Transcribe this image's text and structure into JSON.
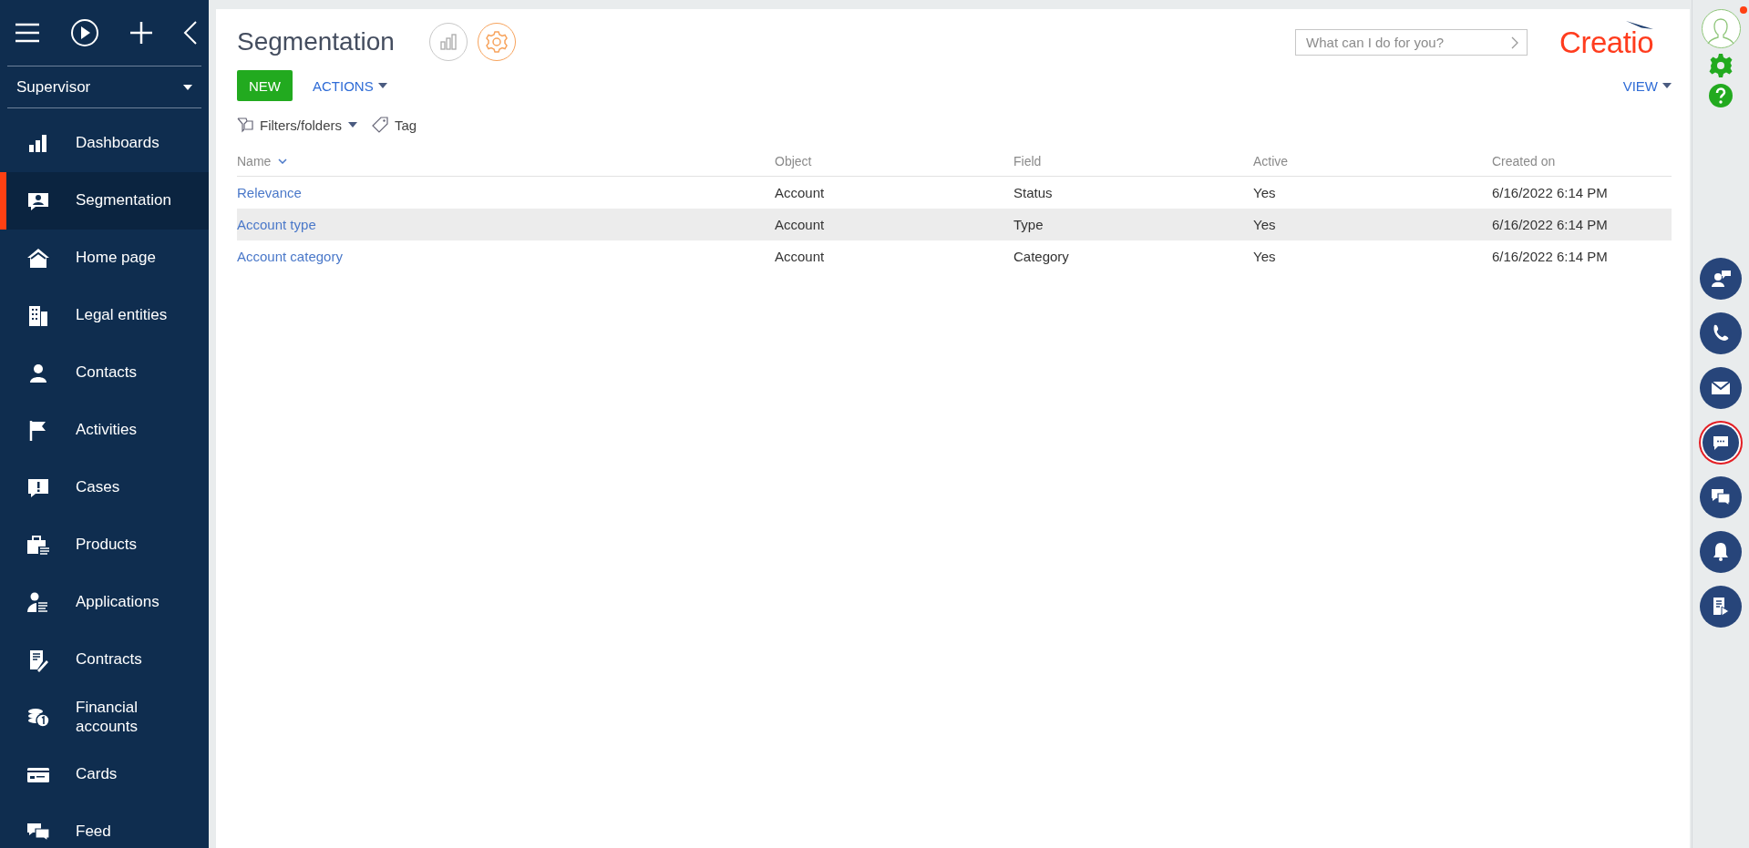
{
  "sidebar": {
    "role": "Supervisor",
    "items": [
      {
        "label": "Dashboards",
        "selected": false
      },
      {
        "label": "Segmentation",
        "selected": true
      },
      {
        "label": "Home page",
        "selected": false
      },
      {
        "label": "Legal entities",
        "selected": false
      },
      {
        "label": "Contacts",
        "selected": false
      },
      {
        "label": "Activities",
        "selected": false
      },
      {
        "label": "Cases",
        "selected": false
      },
      {
        "label": "Products",
        "selected": false
      },
      {
        "label": "Applications",
        "selected": false
      },
      {
        "label": "Contracts",
        "selected": false
      },
      {
        "label": "Financial accounts",
        "selected": false
      },
      {
        "label": "Cards",
        "selected": false
      },
      {
        "label": "Feed",
        "selected": false
      }
    ]
  },
  "header": {
    "title": "Segmentation",
    "search": {
      "placeholder": "What can I do for you?"
    },
    "logo": "Creatio"
  },
  "toolbar": {
    "new_button": "NEW",
    "actions_button": "ACTIONS",
    "view_button": "VIEW"
  },
  "filters": {
    "filters_folders": "Filters/folders",
    "tag": "Tag"
  },
  "table": {
    "columns": [
      "Name",
      "Object",
      "Field",
      "Active",
      "Created on"
    ],
    "rows": [
      {
        "cells": [
          "Relevance",
          "Account",
          "Status",
          "Yes",
          "6/16/2022 6:14 PM"
        ],
        "selected": false
      },
      {
        "cells": [
          "Account type",
          "Account",
          "Type",
          "Yes",
          "6/16/2022 6:14 PM"
        ],
        "selected": true
      },
      {
        "cells": [
          "Account category",
          "Account",
          "Category",
          "Yes",
          "6/16/2022 6:14 PM"
        ],
        "selected": false
      }
    ]
  },
  "right_panel": {
    "profile_notification": true,
    "communication_buttons": [
      {
        "selected": false
      },
      {
        "selected": false
      },
      {
        "selected": false
      },
      {
        "selected": true
      },
      {
        "selected": false
      },
      {
        "selected": false
      },
      {
        "selected": false
      }
    ]
  }
}
